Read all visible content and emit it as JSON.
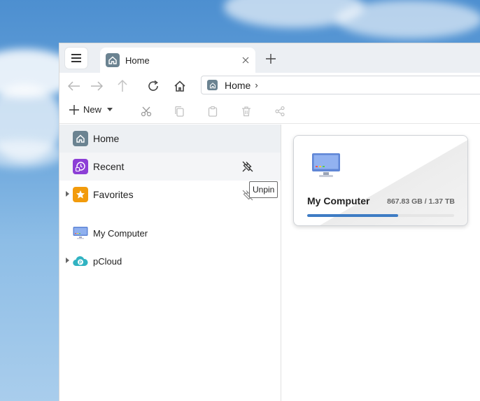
{
  "colors": {
    "accent": "#3e7cc4",
    "recent_icon_bg": "#8c3fd6",
    "favorites_icon_bg": "#f29b0c",
    "home_icon_bg": "#6b8391"
  },
  "tab": {
    "label": "Home",
    "icon": "home-icon"
  },
  "navbar": {
    "back_icon": "arrow-left-icon",
    "forward_icon": "arrow-right-icon",
    "up_icon": "arrow-up-icon",
    "refresh_icon": "refresh-icon",
    "home_icon": "home-icon",
    "address": {
      "label": "Home",
      "separator": "›"
    }
  },
  "toolbar": {
    "new_label": "New",
    "icons": [
      "scissors-icon",
      "copy-icon",
      "paste-icon",
      "trash-icon",
      "share-icon"
    ]
  },
  "sidebar": {
    "items": [
      {
        "label": "Home",
        "icon": "home-icon",
        "selected": true
      },
      {
        "label": "Recent",
        "icon": "clock-icon"
      },
      {
        "label": "Favorites",
        "icon": "star-icon"
      },
      {
        "label": "My Computer",
        "icon": "monitor-icon"
      },
      {
        "label": "pCloud",
        "icon": "cloud-icon"
      }
    ],
    "tooltip": "Unpin"
  },
  "content": {
    "card": {
      "title": "My Computer",
      "size_text": "867.83 GB / 1.37 TB",
      "usage_fraction": 0.62
    }
  }
}
